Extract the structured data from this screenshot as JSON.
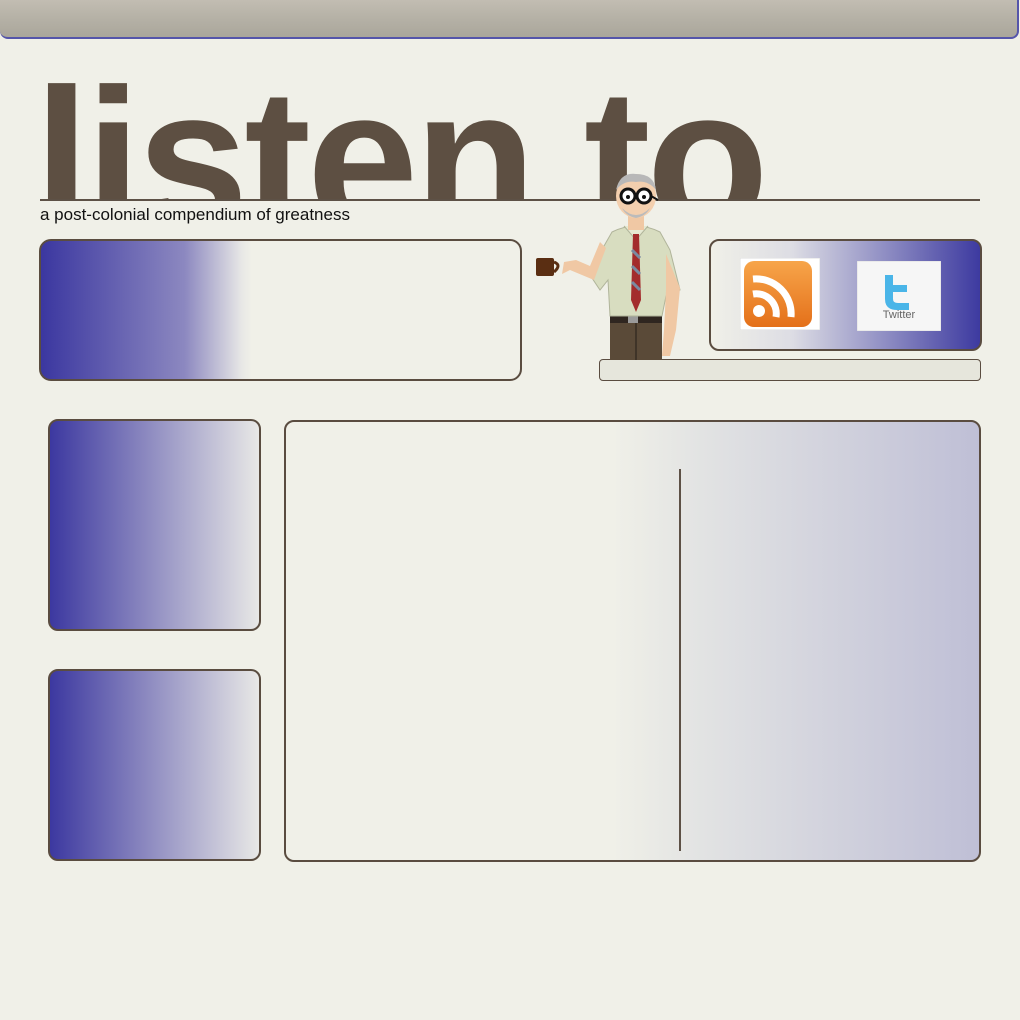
{
  "header": {
    "title": "listen to",
    "tagline": "a post-colonial compendium of greatness"
  },
  "social": {
    "rss_icon": "rss-icon",
    "twitter_icon": "twitter-icon",
    "twitter_label": "Twitter"
  },
  "mascot": {
    "icon": "professor-with-coffee-illustration"
  },
  "colors": {
    "title": "#5d4f42",
    "accent": "#3b37a0",
    "background": "#f0f0e8",
    "border": "#5a4c40",
    "rss": "#f28a1e",
    "twitter": "#4ab5e8"
  }
}
